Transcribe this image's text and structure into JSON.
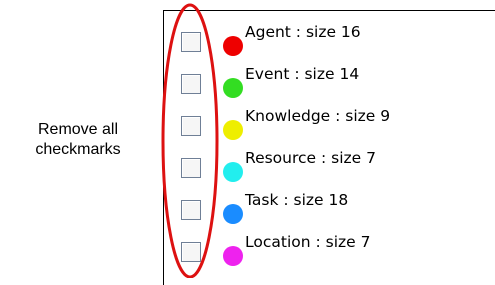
{
  "annotation": {
    "line1": "Remove all",
    "line2": "checkmarks"
  },
  "legend": {
    "items": [
      {
        "label": "Agent : size 16",
        "color": "#ee0000",
        "checked": false
      },
      {
        "label": "Event : size 14",
        "color": "#33dd22",
        "checked": false
      },
      {
        "label": "Knowledge : size 9",
        "color": "#eeee00",
        "checked": false
      },
      {
        "label": "Resource : size 7",
        "color": "#22eeee",
        "checked": false
      },
      {
        "label": "Task : size 18",
        "color": "#1a8cff",
        "checked": false
      },
      {
        "label": "Location : size 7",
        "color": "#ee22ee",
        "checked": false
      }
    ]
  },
  "highlight": {
    "color": "#dd1111"
  }
}
